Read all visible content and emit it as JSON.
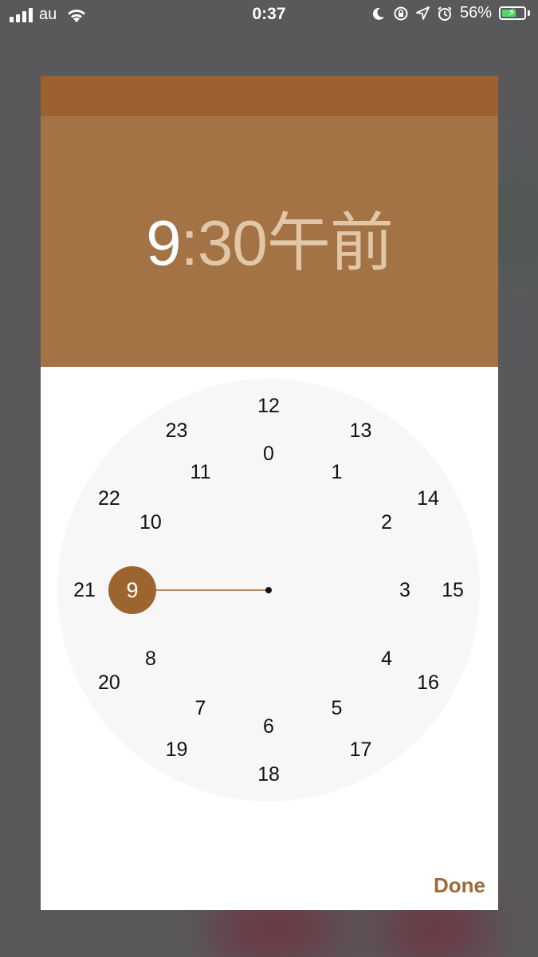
{
  "status_bar": {
    "carrier": "au",
    "time": "0:37",
    "battery_percent": "56%",
    "battery_level": 0.56,
    "icons": [
      "signal-icon",
      "wifi-icon",
      "moon-icon",
      "rotation-lock-icon",
      "location-icon",
      "alarm-icon",
      "battery-icon"
    ]
  },
  "picker": {
    "time_hour": "9",
    "time_rest": ":30午前",
    "selected_hour": 9,
    "outer_hours": [
      "12",
      "13",
      "14",
      "15",
      "16",
      "17",
      "18",
      "19",
      "20",
      "21",
      "22",
      "23"
    ],
    "inner_hours": [
      "0",
      "1",
      "2",
      "3",
      "4",
      "5",
      "6",
      "7",
      "8",
      "9",
      "10",
      "11"
    ],
    "done_label": "Done"
  },
  "colors": {
    "header_bg": "#a47345",
    "header_topbar": "#9b622f",
    "accent": "#a06a36",
    "selector": "#9c6530",
    "face_bg": "#f8f7f8"
  }
}
